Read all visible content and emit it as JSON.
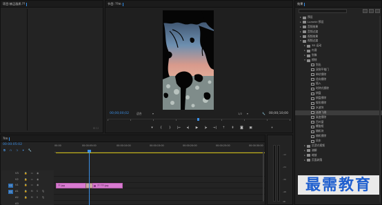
{
  "source_panel": {
    "tab_label": "项目:修正画质.??"
  },
  "program_monitor": {
    "tab_label": "节目: ??m",
    "current_timecode": "00;00;00;02",
    "fit_label": "适合",
    "quality_label": "1/2",
    "duration_timecode": "00;00;10;00",
    "controls": [
      "marker",
      "in",
      "out",
      "go-to-in",
      "step-back",
      "play",
      "step-forward",
      "go-to-out",
      "lift",
      "extract",
      "export-frame",
      "compare",
      "add"
    ]
  },
  "effects_panel": {
    "tab_label": "效果",
    "items": [
      {
        "label": "预设",
        "kind": "folder",
        "level": 0,
        "arrow": "▸"
      },
      {
        "label": "Lumetri 预设",
        "kind": "folder",
        "level": 0,
        "arrow": "▸"
      },
      {
        "label": "音频效果",
        "kind": "folder",
        "level": 0,
        "arrow": "▸"
      },
      {
        "label": "音频过渡",
        "kind": "folder",
        "level": 0,
        "arrow": "▸"
      },
      {
        "label": "视频效果",
        "kind": "folder",
        "level": 0,
        "arrow": "▸"
      },
      {
        "label": "视频过渡",
        "kind": "folder",
        "level": 0,
        "arrow": "▾"
      },
      {
        "label": "3D 运动",
        "kind": "folder",
        "level": 1,
        "arrow": "▸"
      },
      {
        "label": "内滑",
        "kind": "folder",
        "level": 1,
        "arrow": "▸"
      },
      {
        "label": "划像",
        "kind": "folder",
        "level": 1,
        "arrow": "▸"
      },
      {
        "label": "擦除",
        "kind": "folder",
        "level": 1,
        "arrow": "▾"
      },
      {
        "label": "划出",
        "kind": "item",
        "level": 2
      },
      {
        "label": "双侧平推门",
        "kind": "item",
        "level": 2
      },
      {
        "label": "带状擦除",
        "kind": "item",
        "level": 2
      },
      {
        "label": "径向擦除",
        "kind": "item",
        "level": 2
      },
      {
        "label": "插入",
        "kind": "item",
        "level": 2
      },
      {
        "label": "时钟式擦除",
        "kind": "item",
        "level": 2
      },
      {
        "label": "棋盘",
        "kind": "item",
        "level": 2
      },
      {
        "label": "棋盘擦除",
        "kind": "item",
        "level": 2
      },
      {
        "label": "楔形擦除",
        "kind": "item",
        "level": 2
      },
      {
        "label": "水波块",
        "kind": "item",
        "level": 2
      },
      {
        "label": "油漆飞溅",
        "kind": "item",
        "level": 2,
        "selected": true
      },
      {
        "label": "渐变擦除",
        "kind": "item",
        "level": 2
      },
      {
        "label": "百叶窗",
        "kind": "item",
        "level": 2
      },
      {
        "label": "螺旋框",
        "kind": "item",
        "level": 2
      },
      {
        "label": "随机块",
        "kind": "item",
        "level": 2
      },
      {
        "label": "随机擦除",
        "kind": "item",
        "level": 2
      },
      {
        "label": "风车",
        "kind": "item",
        "level": 2
      },
      {
        "label": "沉浸式视频",
        "kind": "folder",
        "level": 1,
        "arrow": "▸"
      },
      {
        "label": "溶解",
        "kind": "folder",
        "level": 1,
        "arrow": "▸"
      },
      {
        "label": "缩放",
        "kind": "folder",
        "level": 1,
        "arrow": "▸"
      },
      {
        "label": "页面剥落",
        "kind": "folder",
        "level": 1,
        "arrow": "▸"
      }
    ]
  },
  "timeline": {
    "tab_label": "?lm",
    "current_timecode": "00:00:05:02",
    "ruler_labels": [
      "00:00",
      "00:00:05:00",
      "00:00:10:00",
      "00:00:15:00",
      "00:00:20:00",
      "00:00:25:00",
      "00:00:30:00"
    ],
    "tracks": [
      {
        "name": "V3",
        "target": "",
        "kind": "video"
      },
      {
        "name": "V2",
        "target": "",
        "kind": "video"
      },
      {
        "name": "V1",
        "target": "V1",
        "kind": "video"
      },
      {
        "name": "A1",
        "target": "A1",
        "kind": "audio"
      },
      {
        "name": "A2",
        "target": "",
        "kind": "audio"
      },
      {
        "name": "A3",
        "target": "",
        "kind": "audio"
      }
    ],
    "clips": [
      {
        "label": "??.jpg",
        "track": "V1"
      },
      {
        "label": "?? ???.jpg",
        "track": "V1"
      }
    ]
  },
  "audio_meters": {
    "labels": [
      "-12",
      "-24",
      "-36",
      "-48",
      "dB"
    ]
  },
  "watermark": {
    "text": "最需教育"
  }
}
